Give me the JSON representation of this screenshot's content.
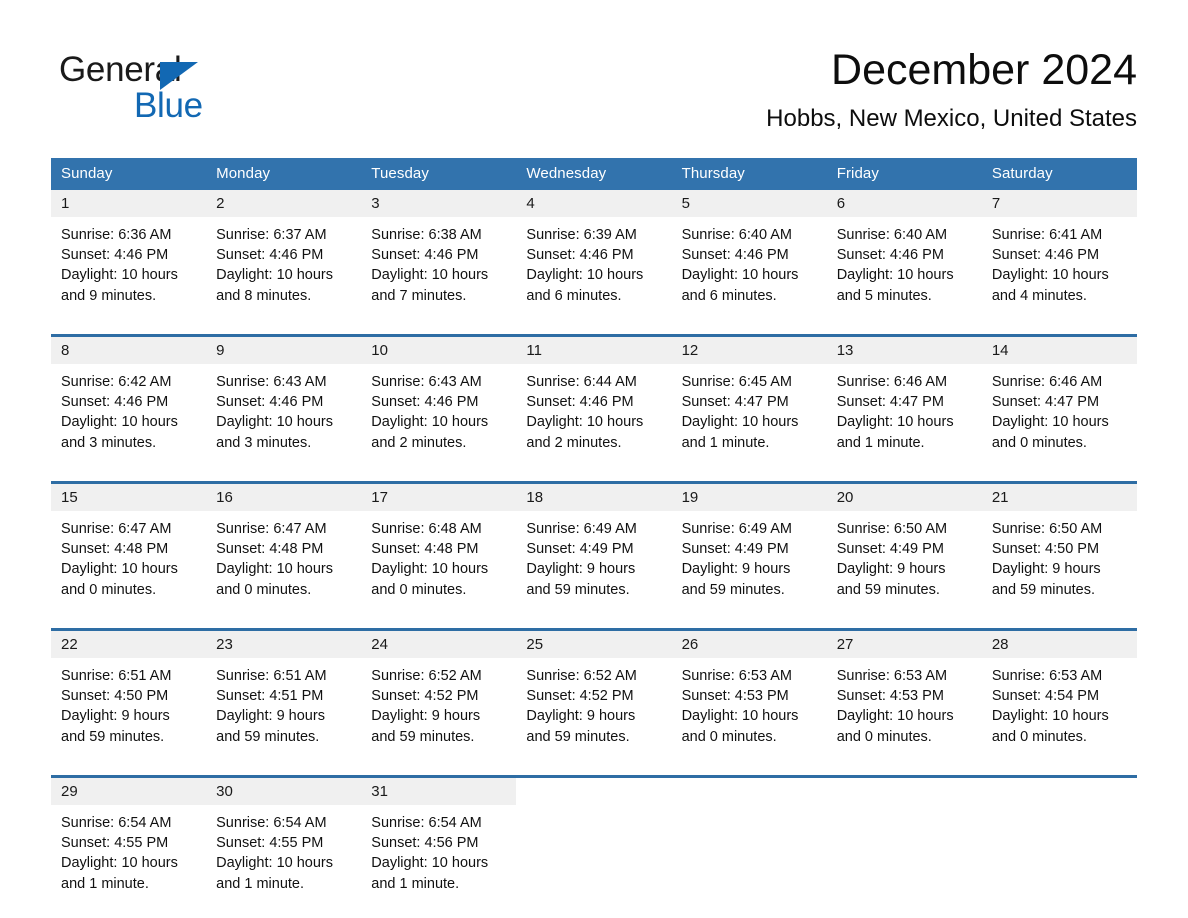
{
  "brand": {
    "name_part1": "General",
    "name_part2": "Blue"
  },
  "header": {
    "month_title": "December 2024",
    "location": "Hobbs, New Mexico, United States"
  },
  "colors": {
    "header_blue": "#3273ad",
    "row_rule_blue": "#2e6da4",
    "daynum_band": "#f0f0f0",
    "logo_blue": "#1268b3",
    "text": "#111111"
  },
  "weekday_headers": [
    "Sunday",
    "Monday",
    "Tuesday",
    "Wednesday",
    "Thursday",
    "Friday",
    "Saturday"
  ],
  "weeks": [
    [
      {
        "day": "1",
        "sunrise": "Sunrise: 6:36 AM",
        "sunset": "Sunset: 4:46 PM",
        "daylight_line1": "Daylight: 10 hours",
        "daylight_line2": "and 9 minutes."
      },
      {
        "day": "2",
        "sunrise": "Sunrise: 6:37 AM",
        "sunset": "Sunset: 4:46 PM",
        "daylight_line1": "Daylight: 10 hours",
        "daylight_line2": "and 8 minutes."
      },
      {
        "day": "3",
        "sunrise": "Sunrise: 6:38 AM",
        "sunset": "Sunset: 4:46 PM",
        "daylight_line1": "Daylight: 10 hours",
        "daylight_line2": "and 7 minutes."
      },
      {
        "day": "4",
        "sunrise": "Sunrise: 6:39 AM",
        "sunset": "Sunset: 4:46 PM",
        "daylight_line1": "Daylight: 10 hours",
        "daylight_line2": "and 6 minutes."
      },
      {
        "day": "5",
        "sunrise": "Sunrise: 6:40 AM",
        "sunset": "Sunset: 4:46 PM",
        "daylight_line1": "Daylight: 10 hours",
        "daylight_line2": "and 6 minutes."
      },
      {
        "day": "6",
        "sunrise": "Sunrise: 6:40 AM",
        "sunset": "Sunset: 4:46 PM",
        "daylight_line1": "Daylight: 10 hours",
        "daylight_line2": "and 5 minutes."
      },
      {
        "day": "7",
        "sunrise": "Sunrise: 6:41 AM",
        "sunset": "Sunset: 4:46 PM",
        "daylight_line1": "Daylight: 10 hours",
        "daylight_line2": "and 4 minutes."
      }
    ],
    [
      {
        "day": "8",
        "sunrise": "Sunrise: 6:42 AM",
        "sunset": "Sunset: 4:46 PM",
        "daylight_line1": "Daylight: 10 hours",
        "daylight_line2": "and 3 minutes."
      },
      {
        "day": "9",
        "sunrise": "Sunrise: 6:43 AM",
        "sunset": "Sunset: 4:46 PM",
        "daylight_line1": "Daylight: 10 hours",
        "daylight_line2": "and 3 minutes."
      },
      {
        "day": "10",
        "sunrise": "Sunrise: 6:43 AM",
        "sunset": "Sunset: 4:46 PM",
        "daylight_line1": "Daylight: 10 hours",
        "daylight_line2": "and 2 minutes."
      },
      {
        "day": "11",
        "sunrise": "Sunrise: 6:44 AM",
        "sunset": "Sunset: 4:46 PM",
        "daylight_line1": "Daylight: 10 hours",
        "daylight_line2": "and 2 minutes."
      },
      {
        "day": "12",
        "sunrise": "Sunrise: 6:45 AM",
        "sunset": "Sunset: 4:47 PM",
        "daylight_line1": "Daylight: 10 hours",
        "daylight_line2": "and 1 minute."
      },
      {
        "day": "13",
        "sunrise": "Sunrise: 6:46 AM",
        "sunset": "Sunset: 4:47 PM",
        "daylight_line1": "Daylight: 10 hours",
        "daylight_line2": "and 1 minute."
      },
      {
        "day": "14",
        "sunrise": "Sunrise: 6:46 AM",
        "sunset": "Sunset: 4:47 PM",
        "daylight_line1": "Daylight: 10 hours",
        "daylight_line2": "and 0 minutes."
      }
    ],
    [
      {
        "day": "15",
        "sunrise": "Sunrise: 6:47 AM",
        "sunset": "Sunset: 4:48 PM",
        "daylight_line1": "Daylight: 10 hours",
        "daylight_line2": "and 0 minutes."
      },
      {
        "day": "16",
        "sunrise": "Sunrise: 6:47 AM",
        "sunset": "Sunset: 4:48 PM",
        "daylight_line1": "Daylight: 10 hours",
        "daylight_line2": "and 0 minutes."
      },
      {
        "day": "17",
        "sunrise": "Sunrise: 6:48 AM",
        "sunset": "Sunset: 4:48 PM",
        "daylight_line1": "Daylight: 10 hours",
        "daylight_line2": "and 0 minutes."
      },
      {
        "day": "18",
        "sunrise": "Sunrise: 6:49 AM",
        "sunset": "Sunset: 4:49 PM",
        "daylight_line1": "Daylight: 9 hours",
        "daylight_line2": "and 59 minutes."
      },
      {
        "day": "19",
        "sunrise": "Sunrise: 6:49 AM",
        "sunset": "Sunset: 4:49 PM",
        "daylight_line1": "Daylight: 9 hours",
        "daylight_line2": "and 59 minutes."
      },
      {
        "day": "20",
        "sunrise": "Sunrise: 6:50 AM",
        "sunset": "Sunset: 4:49 PM",
        "daylight_line1": "Daylight: 9 hours",
        "daylight_line2": "and 59 minutes."
      },
      {
        "day": "21",
        "sunrise": "Sunrise: 6:50 AM",
        "sunset": "Sunset: 4:50 PM",
        "daylight_line1": "Daylight: 9 hours",
        "daylight_line2": "and 59 minutes."
      }
    ],
    [
      {
        "day": "22",
        "sunrise": "Sunrise: 6:51 AM",
        "sunset": "Sunset: 4:50 PM",
        "daylight_line1": "Daylight: 9 hours",
        "daylight_line2": "and 59 minutes."
      },
      {
        "day": "23",
        "sunrise": "Sunrise: 6:51 AM",
        "sunset": "Sunset: 4:51 PM",
        "daylight_line1": "Daylight: 9 hours",
        "daylight_line2": "and 59 minutes."
      },
      {
        "day": "24",
        "sunrise": "Sunrise: 6:52 AM",
        "sunset": "Sunset: 4:52 PM",
        "daylight_line1": "Daylight: 9 hours",
        "daylight_line2": "and 59 minutes."
      },
      {
        "day": "25",
        "sunrise": "Sunrise: 6:52 AM",
        "sunset": "Sunset: 4:52 PM",
        "daylight_line1": "Daylight: 9 hours",
        "daylight_line2": "and 59 minutes."
      },
      {
        "day": "26",
        "sunrise": "Sunrise: 6:53 AM",
        "sunset": "Sunset: 4:53 PM",
        "daylight_line1": "Daylight: 10 hours",
        "daylight_line2": "and 0 minutes."
      },
      {
        "day": "27",
        "sunrise": "Sunrise: 6:53 AM",
        "sunset": "Sunset: 4:53 PM",
        "daylight_line1": "Daylight: 10 hours",
        "daylight_line2": "and 0 minutes."
      },
      {
        "day": "28",
        "sunrise": "Sunrise: 6:53 AM",
        "sunset": "Sunset: 4:54 PM",
        "daylight_line1": "Daylight: 10 hours",
        "daylight_line2": "and 0 minutes."
      }
    ],
    [
      {
        "day": "29",
        "sunrise": "Sunrise: 6:54 AM",
        "sunset": "Sunset: 4:55 PM",
        "daylight_line1": "Daylight: 10 hours",
        "daylight_line2": "and 1 minute."
      },
      {
        "day": "30",
        "sunrise": "Sunrise: 6:54 AM",
        "sunset": "Sunset: 4:55 PM",
        "daylight_line1": "Daylight: 10 hours",
        "daylight_line2": "and 1 minute."
      },
      {
        "day": "31",
        "sunrise": "Sunrise: 6:54 AM",
        "sunset": "Sunset: 4:56 PM",
        "daylight_line1": "Daylight: 10 hours",
        "daylight_line2": "and 1 minute."
      },
      {
        "day": "",
        "sunrise": "",
        "sunset": "",
        "daylight_line1": "",
        "daylight_line2": ""
      },
      {
        "day": "",
        "sunrise": "",
        "sunset": "",
        "daylight_line1": "",
        "daylight_line2": ""
      },
      {
        "day": "",
        "sunrise": "",
        "sunset": "",
        "daylight_line1": "",
        "daylight_line2": ""
      },
      {
        "day": "",
        "sunrise": "",
        "sunset": "",
        "daylight_line1": "",
        "daylight_line2": ""
      }
    ]
  ]
}
